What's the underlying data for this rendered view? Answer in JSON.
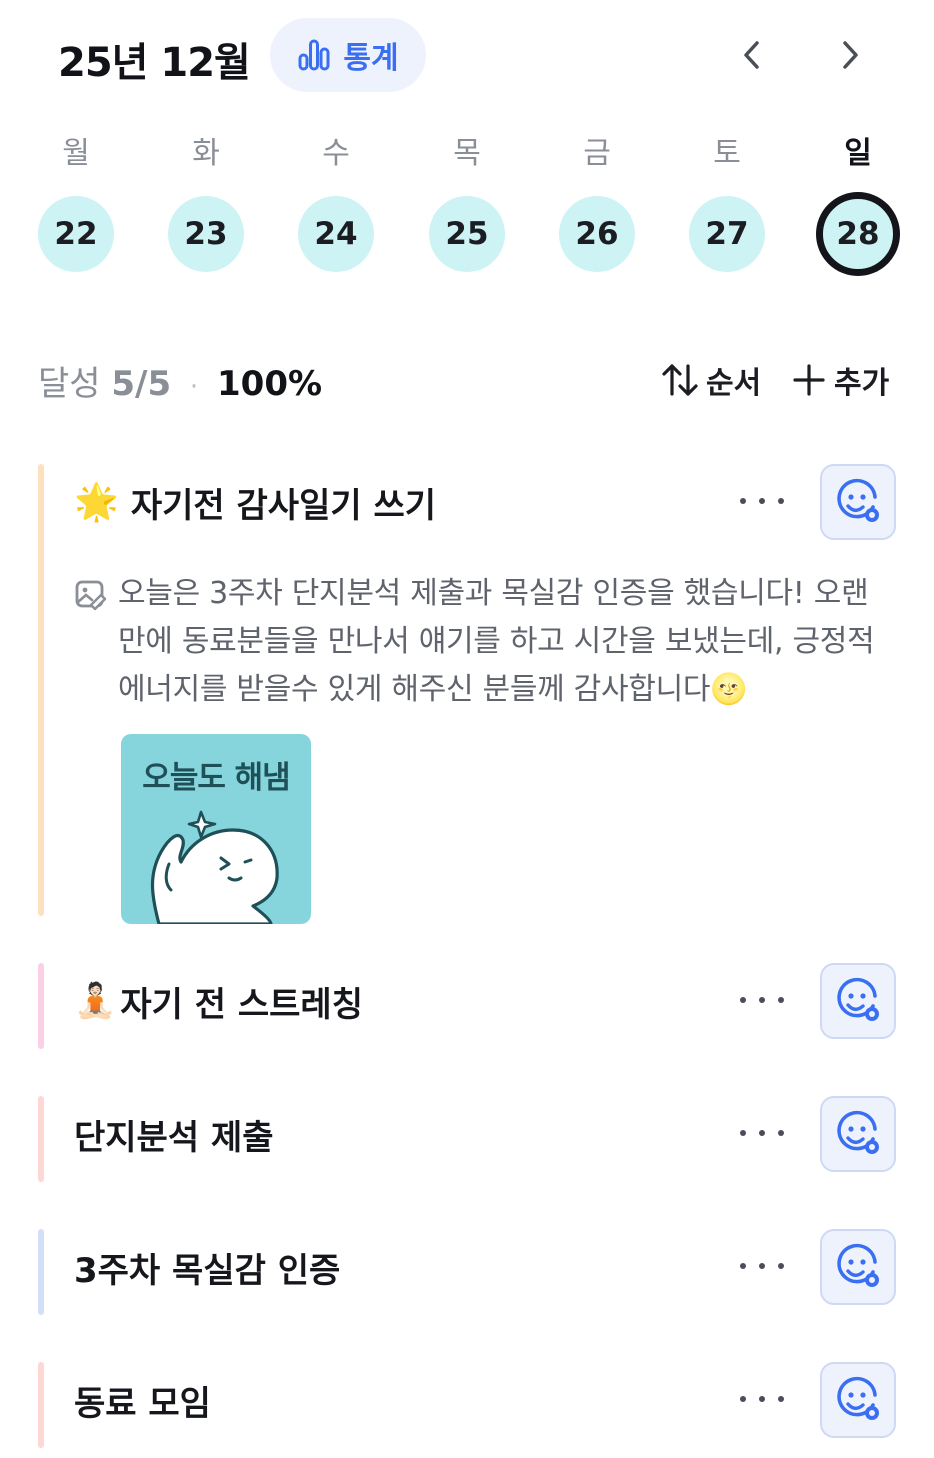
{
  "header": {
    "month_title": "25년 12월",
    "stats_label": "통계",
    "prev_icon": "chevron-left-icon",
    "next_icon": "chevron-right-icon"
  },
  "week": {
    "days": [
      {
        "weekday": "월",
        "date": "22"
      },
      {
        "weekday": "화",
        "date": "23"
      },
      {
        "weekday": "수",
        "date": "24"
      },
      {
        "weekday": "목",
        "date": "25"
      },
      {
        "weekday": "금",
        "date": "26"
      },
      {
        "weekday": "토",
        "date": "27"
      },
      {
        "weekday": "일",
        "date": "28",
        "selected": true
      }
    ]
  },
  "summary": {
    "label": "달성",
    "count": "5/5",
    "separator": "·",
    "percent": "100%",
    "order_label": "순서",
    "add_label": "추가"
  },
  "habits": [
    {
      "emoji": "🌟",
      "title": "자기전 감사일기 쓰기",
      "bar_color": "#fde1bf",
      "memo": "오늘은 3주차 단지분석 제출과 목실감 인증을 했습니다! 오랜만에 동료분들을 만나서 얘기를 하고 시간을 보냈는데, 긍정적 에너지를 받을수 있게 해주신 분들께 감사합니다🌝",
      "image_text": "오늘도 해냄"
    },
    {
      "emoji": "🧘🏻",
      "title": "자기 전 스트레칭",
      "bar_color": "#fbd0e4"
    },
    {
      "emoji": "",
      "title": "단지분석 제출",
      "bar_color": "#fcd7d3"
    },
    {
      "emoji": "",
      "title": "3주차 목실감 인증",
      "bar_color": "#d3def8"
    },
    {
      "emoji": "",
      "title": "동료 모임",
      "bar_color": "#fcd7d3"
    }
  ],
  "colors": {
    "accent": "#3a6ff2",
    "date_bg": "#cdf3f4",
    "selected_ring": "#13151a"
  }
}
